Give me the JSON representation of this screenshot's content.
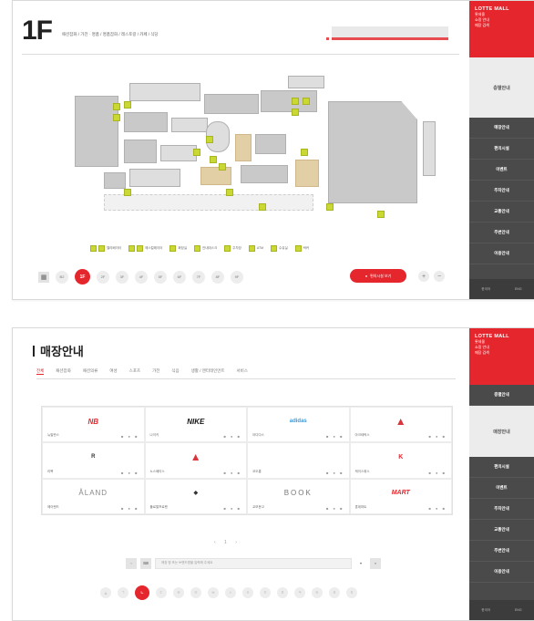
{
  "kiosk1": {
    "floor": "1F",
    "categories": "패션잡화 / 가전 · 명품 / 명품잡화 / 레스토랑 / 카페 / 식당",
    "legend": [
      {
        "code": "EV",
        "label": "엘리베이터"
      },
      {
        "code": "ES",
        "label": "에스컬레이터"
      },
      {
        "code": "WC",
        "label": "화장실"
      },
      {
        "code": "I",
        "label": "안내데스크"
      },
      {
        "code": "P",
        "label": "주차장"
      },
      {
        "code": "A",
        "label": "ATM"
      },
      {
        "code": "N",
        "label": "수유실"
      },
      {
        "code": "L",
        "label": "락커"
      }
    ],
    "floors": [
      "B2",
      "B1",
      "1F",
      "2F",
      "3F",
      "4F",
      "5F",
      "6F",
      "7F",
      "8F",
      "9F"
    ],
    "active_floor": "1F",
    "facility_button": "편의시설 보기",
    "zoom_in": "+",
    "zoom_out": "−"
  },
  "sidebar1": {
    "logo_title": "LOTTE MALL",
    "logo_lines": [
      "롯데몰",
      "쇼핑 안내",
      "매장 검색"
    ],
    "selected": "층별안내",
    "items": [
      "매장안내",
      "편의시설",
      "이벤트",
      "주차안내",
      "교통안내",
      "주변안내",
      "이용안내"
    ],
    "foot": [
      "한국어",
      "ENG"
    ]
  },
  "kiosk2": {
    "title": "매장안내",
    "tabs": [
      "전체",
      "패션잡화",
      "패션의류",
      "여성",
      "스포츠",
      "가전",
      "식음",
      "생활 / 엔터테인먼트",
      "서비스"
    ],
    "stores": [
      {
        "logo": "NB",
        "name": "뉴발란스"
      },
      {
        "logo": "NIKE",
        "name": "나이키"
      },
      {
        "logo": "adidas",
        "name": "아디다스"
      },
      {
        "logo": "▲",
        "name": "아크테릭스"
      },
      {
        "logo": "R",
        "name": "리복"
      },
      {
        "logo": "▲",
        "name": "노스페이스"
      },
      {
        "logo": "",
        "name": "코오롱"
      },
      {
        "logo": "K",
        "name": "케이스위스"
      },
      {
        "logo": "ÅLAND",
        "name": "에이랜드"
      },
      {
        "logo": "◆",
        "name": "폴로랄프로렌"
      },
      {
        "logo": "BOOK",
        "name": "교보문고"
      },
      {
        "logo": "MART",
        "name": "롯데마트"
      }
    ],
    "pager": "‹ 1 ›",
    "search_placeholder": "매장 명 또는 브랜드명을 입력해 주세요",
    "consonants": [
      "A",
      "ㄱ",
      "ㄴ",
      "ㄷ",
      "ㄹ",
      "ㅁ",
      "ㅂ",
      "ㅅ",
      "ㅇ",
      "ㅈ",
      "ㅊ",
      "ㅋ",
      "ㅌ",
      "ㅍ",
      "ㅎ"
    ],
    "active_consonant": "ㄴ"
  },
  "sidebar2": {
    "logo_title": "LOTTE MALL",
    "logo_lines": [
      "롯데몰",
      "쇼핑 안내",
      "매장 검색"
    ],
    "selected": "매장안내",
    "items_top": [
      "층별안내"
    ],
    "items": [
      "편의시설",
      "이벤트",
      "주차안내",
      "교통안내",
      "주변안내",
      "이용안내"
    ],
    "foot": [
      "한국어",
      "ENG"
    ]
  }
}
